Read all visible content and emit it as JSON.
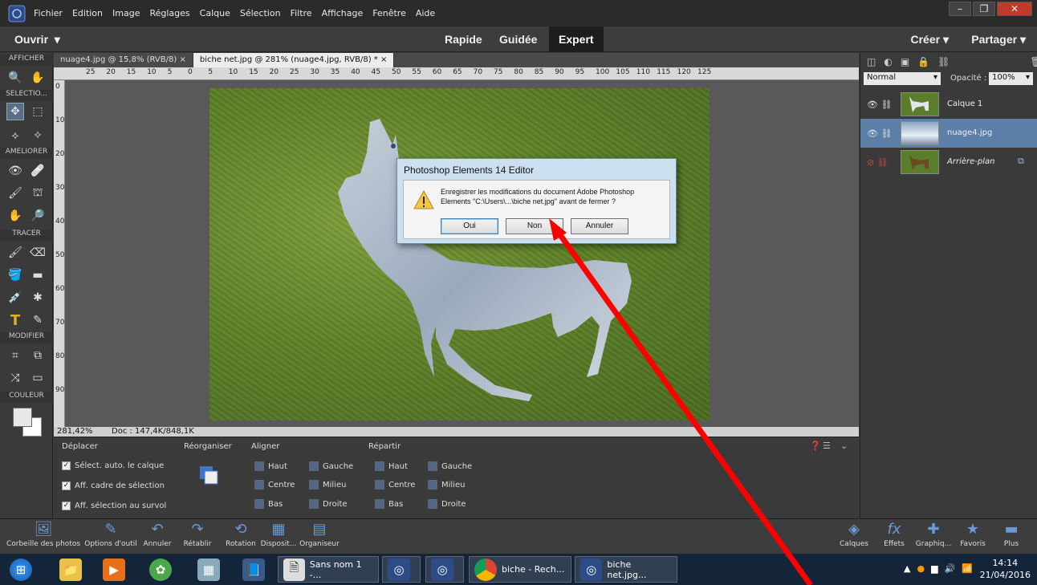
{
  "menubar": {
    "items": [
      "Fichier",
      "Edition",
      "Image",
      "Réglages",
      "Calque",
      "Sélection",
      "Filtre",
      "Affichage",
      "Fenêtre",
      "Aide"
    ]
  },
  "modebar": {
    "open": "Ouvrir",
    "modes": [
      "Rapide",
      "Guidée",
      "Expert"
    ],
    "active_mode": "Expert",
    "create": "Créer",
    "share": "Partager"
  },
  "toolbar": {
    "sections": [
      "AFFICHER",
      "SELECTIO...",
      "AMELIORER",
      "TRACER",
      "MODIFIER",
      "COULEUR"
    ]
  },
  "doctabs": {
    "tabs": [
      "nuage4.jpg @ 15,8% (RVB/8)  ×",
      "biche net.jpg @ 281% (nuage4.jpg, RVB/8) *  ×"
    ]
  },
  "ruler": {
    "h": [
      "25",
      "20",
      "15",
      "10",
      "5",
      "0",
      "5",
      "10",
      "15",
      "20",
      "25",
      "30",
      "35",
      "40",
      "45",
      "50",
      "55",
      "60",
      "65",
      "70",
      "75",
      "80",
      "85",
      "90",
      "95",
      "100",
      "105",
      "110",
      "115",
      "120",
      "125"
    ],
    "v": [
      "0",
      "10",
      "20",
      "30",
      "40",
      "50",
      "60",
      "70",
      "80",
      "90"
    ]
  },
  "status": {
    "zoom": "281,42%",
    "doc": "Doc : 147,4K/848,1K"
  },
  "options": {
    "move_title": "Déplacer",
    "reorganize": "Réorganiser",
    "align": "Aligner",
    "distribute": "Répartir",
    "checkboxes": [
      "Sélect. auto. le calque",
      "Aff. cadre de sélection",
      "Aff. sélection au survol"
    ],
    "align_items": [
      "Haut",
      "Gauche",
      "Centre",
      "Milieu",
      "Bas",
      "Droite"
    ],
    "distribute_items": [
      "Haut",
      "Gauche",
      "Centre",
      "Milieu",
      "Bas",
      "Droite"
    ]
  },
  "layers": {
    "blend": "Normal",
    "opacity_label": "Opacité :",
    "opacity": "100%",
    "items": [
      {
        "name": "Calque 1"
      },
      {
        "name": "nuage4.jpg"
      },
      {
        "name": "Arrière-plan"
      }
    ]
  },
  "bottombar": {
    "left": [
      "Corbeille des photos",
      "Options d'outil",
      "Annuler",
      "Rétablir",
      "Rotation",
      "Disposit...",
      "Organiseur"
    ],
    "right": [
      "Calques",
      "Effets",
      "Graphiq...",
      "Favoris",
      "Plus"
    ]
  },
  "dialog": {
    "title": "Photoshop Elements 14 Editor",
    "message": "Enregistrer les modifications du document Adobe Photoshop Elements \"C:\\Users\\...\\biche net.jpg\" avant de fermer ?",
    "buttons": [
      "Oui",
      "Non",
      "Annuler"
    ]
  },
  "taskbar": {
    "items": [
      "Sans nom 1 -...",
      "biche - Rech...",
      "biche net.jpg..."
    ],
    "time": "14:14",
    "date": "21/04/2016"
  },
  "colors": {
    "accent": "#5c7fa8",
    "arrow": "#ff0000"
  }
}
